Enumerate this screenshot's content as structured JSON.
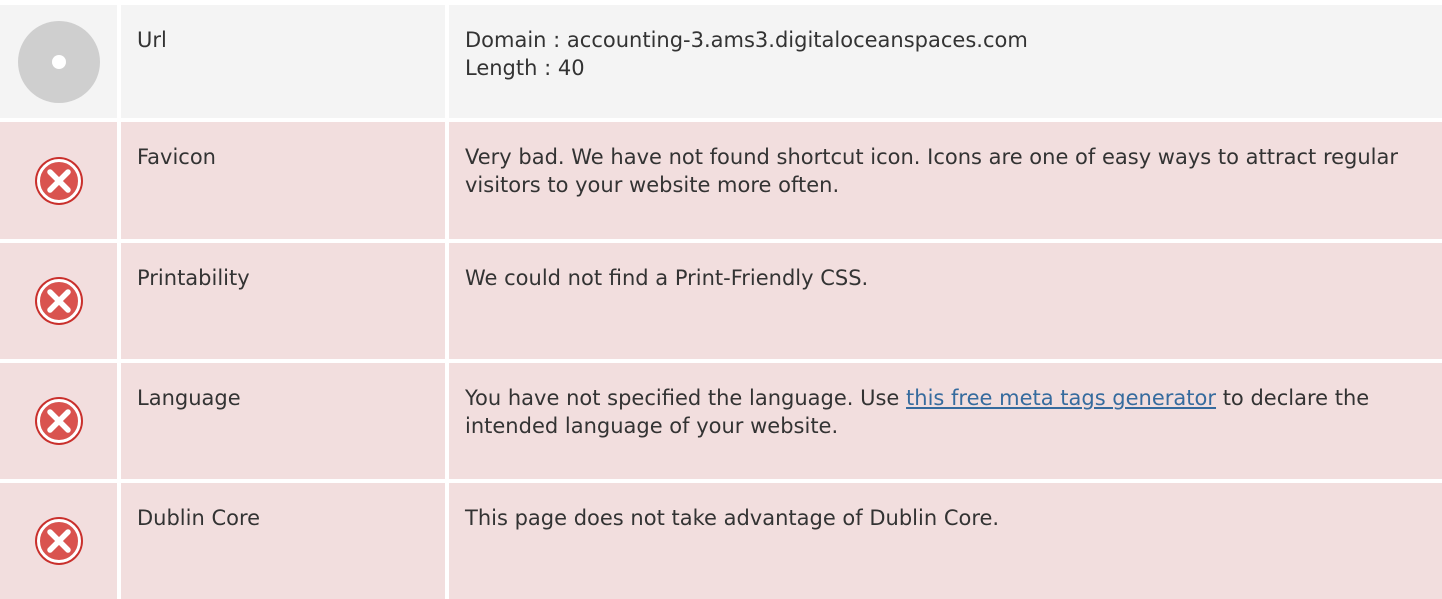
{
  "colors": {
    "neutral_row_bg": "#f4f4f4",
    "error_row_bg": "#f2dede",
    "error_icon": "#d9534f",
    "link": "#366b9e"
  },
  "rows": [
    {
      "status": "neutral",
      "icon": "neutral-dot-icon",
      "label": "Url",
      "desc_line1": "Domain : accounting-3.ams3.digitaloceanspaces.com",
      "desc_line2": "Length : 40"
    },
    {
      "status": "error",
      "icon": "error-x-icon",
      "label": "Favicon",
      "desc": "Very bad. We have not found shortcut icon. Icons are one of easy ways to attract regular visitors to your website more often."
    },
    {
      "status": "error",
      "icon": "error-x-icon",
      "label": "Printability",
      "desc": "We could not find a Print-Friendly CSS."
    },
    {
      "status": "error",
      "icon": "error-x-icon",
      "label": "Language",
      "desc_before": "You have not specified the language. Use ",
      "desc_link": "this free meta tags generator",
      "desc_after": " to declare the intended language of your website."
    },
    {
      "status": "error",
      "icon": "error-x-icon",
      "label": "Dublin Core",
      "desc": "This page does not take advantage of Dublin Core."
    }
  ]
}
